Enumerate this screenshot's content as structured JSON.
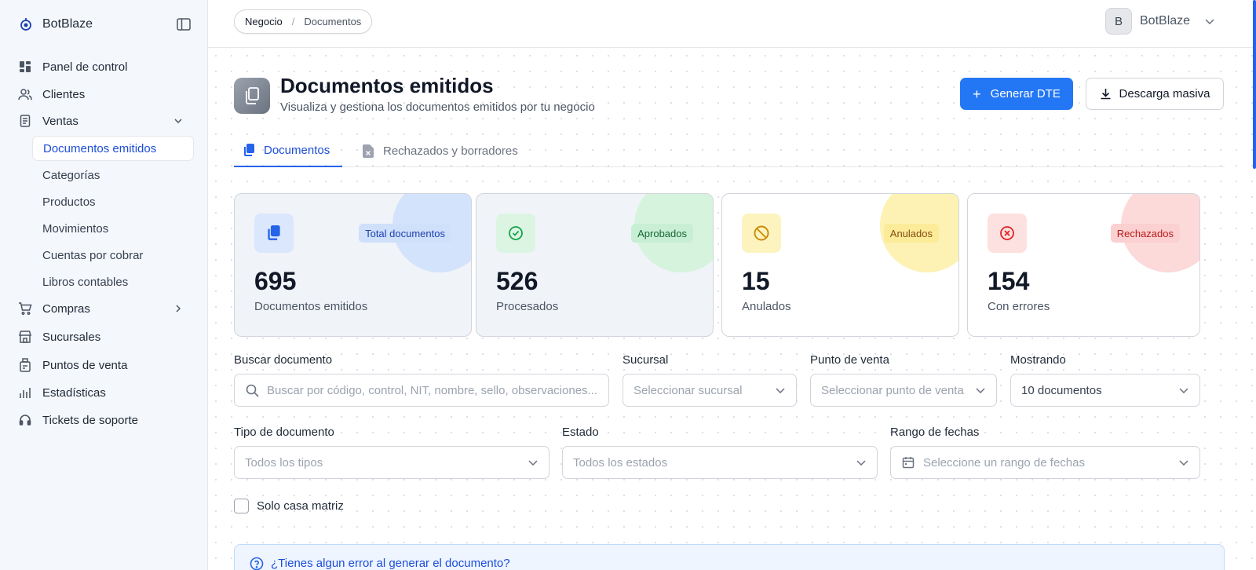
{
  "app": {
    "name": "BotBlaze"
  },
  "sidebar": {
    "items": [
      {
        "label": "Panel de control"
      },
      {
        "label": "Clientes"
      },
      {
        "label": "Ventas"
      },
      {
        "label": "Compras"
      },
      {
        "label": "Sucursales"
      },
      {
        "label": "Puntos de venta"
      },
      {
        "label": "Estadísticas"
      },
      {
        "label": "Tickets de soporte"
      }
    ],
    "ventas_sub": [
      {
        "label": "Documentos emitidos",
        "active": true
      },
      {
        "label": "Categorías"
      },
      {
        "label": "Productos"
      },
      {
        "label": "Movimientos"
      },
      {
        "label": "Cuentas por cobrar"
      },
      {
        "label": "Libros contables"
      }
    ]
  },
  "header": {
    "breadcrumb": [
      "Negocio",
      "Documentos"
    ],
    "separator": "/",
    "user": {
      "initial": "B",
      "name": "BotBlaze"
    }
  },
  "page": {
    "title": "Documentos emitidos",
    "subtitle": "Visualiza y gestiona los documentos emitidos por tu negocio",
    "primary_button": "Generar DTE",
    "secondary_button": "Descarga masiva"
  },
  "tabs": [
    {
      "label": "Documentos",
      "active": true
    },
    {
      "label": "Rechazados y borradores"
    }
  ],
  "stats": [
    {
      "badge": "Total documentos",
      "value": "695",
      "label": "Documentos emitidos",
      "accent": "#2563eb",
      "blob": "#d3e3fc",
      "badge_bg": "#cfe0fb",
      "badge_fg": "#1e40af",
      "icon_bg": "#dbe7fd"
    },
    {
      "badge": "Aprobados",
      "value": "526",
      "label": "Procesados",
      "accent": "#16a34a",
      "blob": "#d5f3dd",
      "badge_bg": "#c8efd4",
      "badge_fg": "#166534",
      "icon_bg": "#dcf5e3"
    },
    {
      "badge": "Anulados",
      "value": "15",
      "label": "Anulados",
      "accent": "#ca8a04",
      "blob": "#fdf2b3",
      "badge_bg": "#fcec9a",
      "badge_fg": "#854d0e",
      "icon_bg": "#fdf3bf"
    },
    {
      "badge": "Rechazados",
      "value": "154",
      "label": "Con errores",
      "accent": "#dc2626",
      "blob": "#fcdada",
      "badge_bg": "#fbd0d0",
      "badge_fg": "#b91c1c",
      "icon_bg": "#fde0e0"
    }
  ],
  "filters": {
    "search": {
      "label": "Buscar documento",
      "placeholder": "Buscar por código, control, NIT, nombre, sello, observaciones..."
    },
    "sucursal": {
      "label": "Sucursal",
      "placeholder": "Seleccionar sucursal"
    },
    "punto_venta": {
      "label": "Punto de venta",
      "placeholder": "Seleccionar punto de venta"
    },
    "mostrando": {
      "label": "Mostrando",
      "value": "10 documentos"
    },
    "tipo": {
      "label": "Tipo de documento",
      "placeholder": "Todos los tipos"
    },
    "estado": {
      "label": "Estado",
      "placeholder": "Todos los estados"
    },
    "rango": {
      "label": "Rango de fechas",
      "placeholder": "Seleccione un rango de fechas"
    },
    "casa_matriz": {
      "label": "Solo casa matriz",
      "checked": false
    }
  },
  "help": {
    "text": "¿Tienes algun error al generar el documento?"
  }
}
